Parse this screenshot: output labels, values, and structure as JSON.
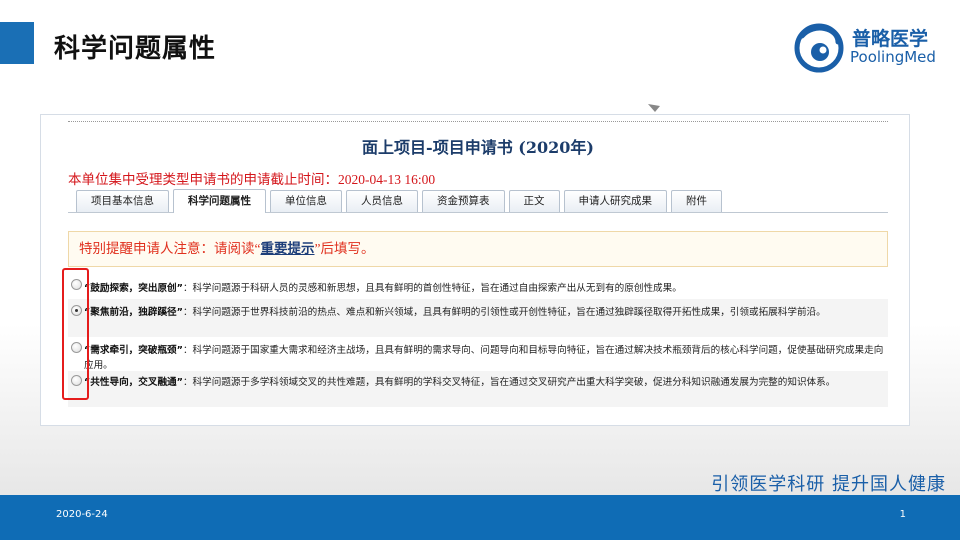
{
  "slide": {
    "title": "科学问题属性",
    "logo_cn": "普略医学",
    "logo_en": "PoolingMed",
    "slogan": "引领医学科研  提升国人健康",
    "date": "2020-6-24",
    "page_number": "1"
  },
  "screenshot": {
    "page_title": "面上项目-项目申请书 (2020年)",
    "deadline": "本单位集中受理类型申请书的申请截止时间：2020-04-13 16:00",
    "tabs": [
      {
        "label": "项目基本信息",
        "active": false
      },
      {
        "label": "科学问题属性",
        "active": true
      },
      {
        "label": "单位信息",
        "active": false
      },
      {
        "label": "人员信息",
        "active": false
      },
      {
        "label": "资金预算表",
        "active": false
      },
      {
        "label": "正文",
        "active": false
      },
      {
        "label": "申请人研究成果",
        "active": false
      },
      {
        "label": "附件",
        "active": false
      }
    ],
    "notice": {
      "prefix": "特别提醒申请人注意：请阅读“",
      "link": "重要提示",
      "suffix": "”后填写。"
    },
    "options": [
      {
        "name": "“鼓励探索，突出原创”",
        "desc": "：科学问题源于科研人员的灵感和新思想，且具有鲜明的首创性特征，旨在通过自由探索产出从无到有的原创性成果。",
        "checked": false
      },
      {
        "name": "“聚焦前沿，独辟蹊径”",
        "desc": "：科学问题源于世界科技前沿的热点、难点和新兴领域，且具有鲜明的引领性或开创性特征，旨在通过独辟蹊径取得开拓性成果，引领或拓展科学前沿。",
        "checked": true
      },
      {
        "name": "“需求牵引，突破瓶颈”",
        "desc": "：科学问题源于国家重大需求和经济主战场，且具有鲜明的需求导向、问题导向和目标导向特征，旨在通过解决技术瓶颈背后的核心科学问题，促使基础研究成果走向应用。",
        "checked": false
      },
      {
        "name": "“共性导向，交叉融通”",
        "desc": "：科学问题源于多学科领域交叉的共性难题，具有鲜明的学科交叉特征，旨在通过交叉研究产出重大科学突破，促进分科知识融通发展为完整的知识体系。",
        "checked": false
      }
    ]
  },
  "colors": {
    "accent_blue": "#1a6fb5",
    "highlight_red": "#e51c1c",
    "deadline_red": "#d4161b"
  }
}
